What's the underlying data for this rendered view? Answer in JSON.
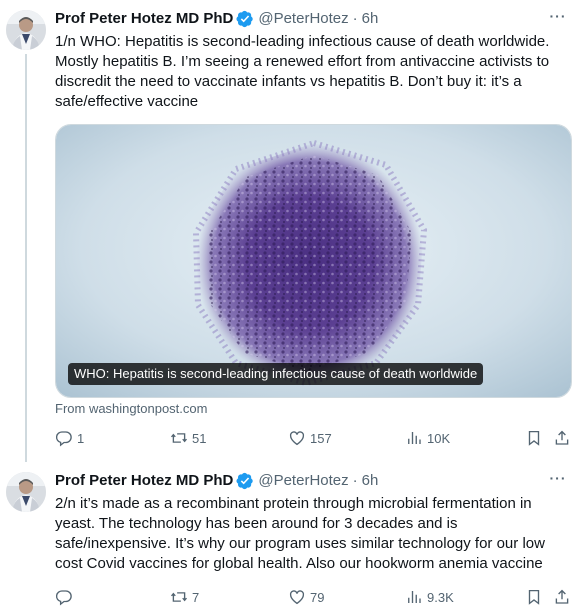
{
  "tweets": [
    {
      "author_name": "Prof Peter Hotez MD PhD",
      "handle": "@PeterHotez",
      "separator": "·",
      "time": "6h",
      "more_label": "···",
      "text": "1/n WHO: Hepatitis is second-leading infectious cause of death worldwide. Mostly hepatitis B. I’m seeing a renewed effort from antivaccine activists to discredit the need to vaccinate infants vs hepatitis B. Don’t buy it: it’s a safe/effective vaccine",
      "card": {
        "caption": "WHO: Hepatitis is second-leading infectious cause of death worldwide",
        "source": "From washingtonpost.com"
      },
      "stats": {
        "replies": "1",
        "retweets": "51",
        "likes": "157",
        "views": "10K"
      }
    },
    {
      "author_name": "Prof Peter Hotez MD PhD",
      "handle": "@PeterHotez",
      "separator": "·",
      "time": "6h",
      "more_label": "···",
      "text": "2/n it’s made as a recombinant protein through microbial fermentation in yeast. The technology has been around for 3 decades and is safe/inexpensive. It’s why our program uses similar technology for our low cost Covid vaccines for global health. Also our hookworm anemia vaccine",
      "stats": {
        "replies": "",
        "retweets": "7",
        "likes": "79",
        "views": "9.3K"
      }
    }
  ],
  "colors": {
    "verified": "#1d9bf0",
    "secondary_text": "#536471",
    "thread_line": "#cfd9de",
    "virus": "#5b3f92",
    "image_background": "#d5e3ec"
  },
  "icons": [
    "verified-badge-icon",
    "reply-icon",
    "retweet-icon",
    "like-icon",
    "views-icon",
    "bookmark-icon",
    "share-icon",
    "more-icon"
  ]
}
